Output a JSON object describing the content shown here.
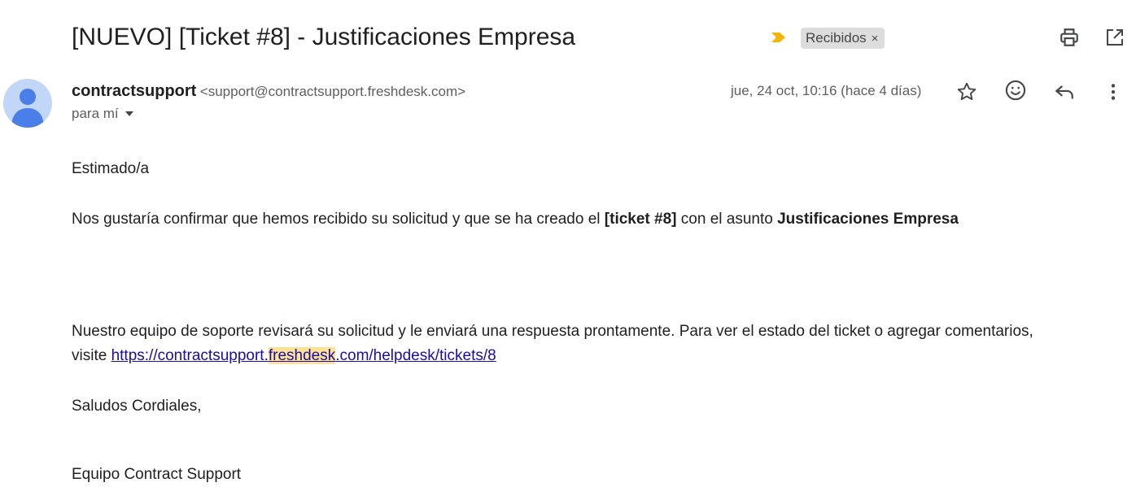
{
  "header": {
    "subject": "[NUEVO] [Ticket #8] - Justificaciones Empresa",
    "label": "Recibidos",
    "label_close": "×",
    "colors": {
      "importance": "#f5b400",
      "chip_bg": "#dddddd"
    }
  },
  "message": {
    "sender_name": "contractsupport",
    "sender_email": "<support@contractsupport.freshdesk.com>",
    "recipient": "para mí",
    "date": "jue, 24 oct, 10:16 (hace 4 días)"
  },
  "body": {
    "greeting": "Estimado/a",
    "confirm_pre": "Nos gustaría confirmar que hemos recibido su solicitud y que se ha creado el ",
    "ticket_ref": "[ticket #8]",
    "confirm_mid": " con el asunto ",
    "ticket_subject": "Justificaciones Empresa",
    "review_line1": "Nuestro equipo de soporte revisará su solicitud y le enviará una respuesta prontamente. Para ver el estado del ticket o agregar comentarios,",
    "review_visit": "visite ",
    "link_part1": "https://contractsupport.",
    "link_highlight": "freshdesk",
    "link_part2": ".com/helpdesk/tickets/8",
    "regards": "Saludos Cordiales,",
    "signature": "Equipo Contract Support"
  },
  "icons": {
    "importance": "importance-marker-icon",
    "print": "print-icon",
    "popout": "open-in-new-window-icon",
    "avatar": "person-avatar-icon",
    "star": "star-icon",
    "emoji": "emoji-icon",
    "reply": "reply-icon",
    "more": "more-vert-icon"
  }
}
